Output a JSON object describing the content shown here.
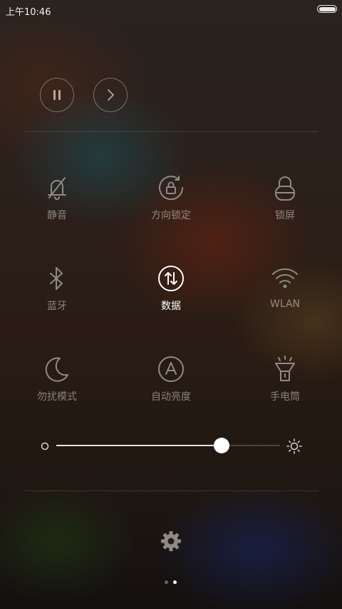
{
  "status_bar": {
    "time": "上午10:46",
    "battery_level": 1.0
  },
  "media_controls": {
    "pause_icon": "pause-icon",
    "next_icon": "chevron-right-icon"
  },
  "tiles": [
    {
      "label": "静音",
      "icon": "bell-off-icon",
      "active": false
    },
    {
      "label": "方向锁定",
      "icon": "rotation-lock-icon",
      "active": false
    },
    {
      "label": "锁屏",
      "icon": "lock-icon",
      "active": false
    },
    {
      "label": "蓝牙",
      "icon": "bluetooth-icon",
      "active": false
    },
    {
      "label": "数据",
      "icon": "mobile-data-icon",
      "active": true
    },
    {
      "label": "WLAN",
      "icon": "wifi-icon",
      "active": false
    },
    {
      "label": "勿扰模式",
      "icon": "moon-icon",
      "active": false
    },
    {
      "label": "自动亮度",
      "icon": "auto-brightness-icon",
      "active": false
    },
    {
      "label": "手电筒",
      "icon": "flashlight-icon",
      "active": false
    }
  ],
  "brightness": {
    "level": 0.74,
    "min_icon": "brightness-low-icon",
    "max_icon": "brightness-high-icon"
  },
  "settings": {
    "icon": "gear-icon"
  },
  "pager": {
    "pages": 2,
    "current": 1
  },
  "colors": {
    "icon_inactive": "#8f8a86",
    "icon_active": "#ffffff",
    "text_inactive": "#8a8582"
  }
}
